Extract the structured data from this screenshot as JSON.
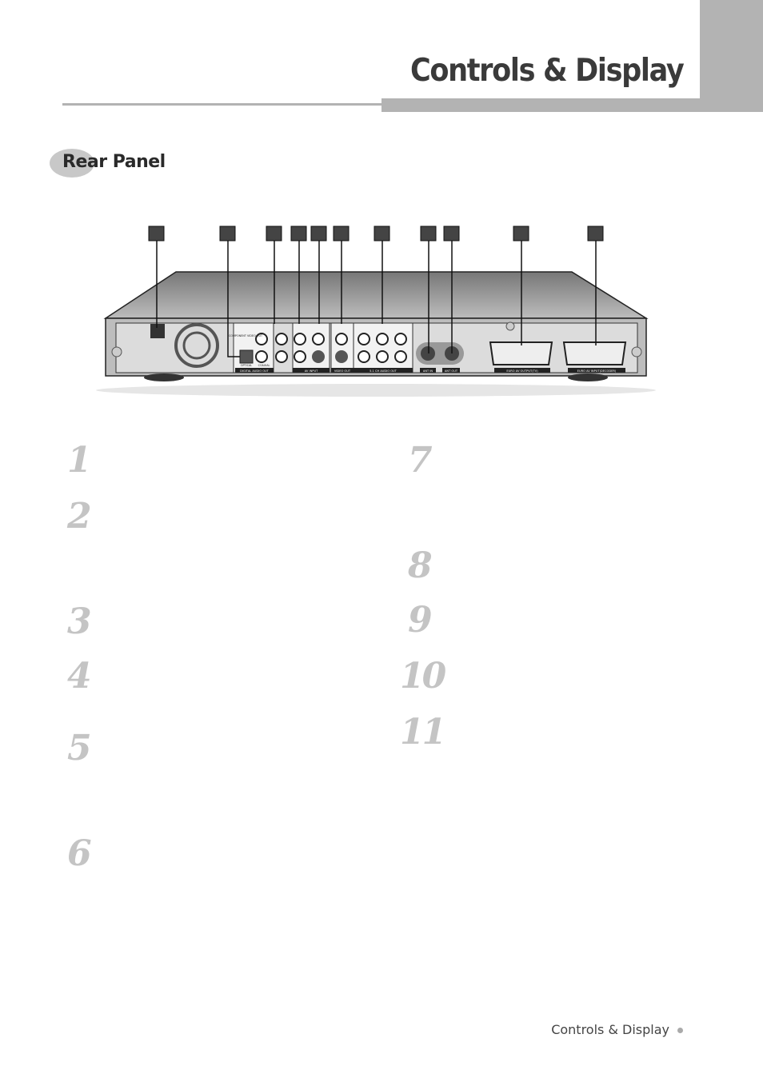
{
  "header": {
    "title": "Controls & Display"
  },
  "section": {
    "title": "Rear Panel"
  },
  "diagram": {
    "callouts": [
      "1",
      "2",
      "3",
      "4",
      "5",
      "6",
      "7",
      "8",
      "9",
      "10",
      "11"
    ],
    "labels": {
      "component": "COMPONENT VIDEO OUT",
      "digital": "DIGITAL AUDIO OUT",
      "optical": "OPTICAL",
      "coaxial": "COAXIAL",
      "av_input": "AV INPUT",
      "video_out": "VIDEO OUT",
      "audio51": "5.1 CH AUDIO OUT",
      "ant_in": "ANT IN",
      "ant_out": "ANT OUT",
      "euro_tv": "EURO AV OUTPUT(TV)",
      "euro_dec": "EURO AV INPUT(DECODER)"
    }
  },
  "items": {
    "left": [
      "1",
      "2",
      "3",
      "4",
      "5",
      "6"
    ],
    "right": [
      "7",
      "8",
      "9",
      "10",
      "11"
    ]
  },
  "footer": {
    "text": "Controls & Display"
  },
  "colors": {
    "accent_gray": "#b3b3b3",
    "number_gray": "#c4c4c4"
  }
}
